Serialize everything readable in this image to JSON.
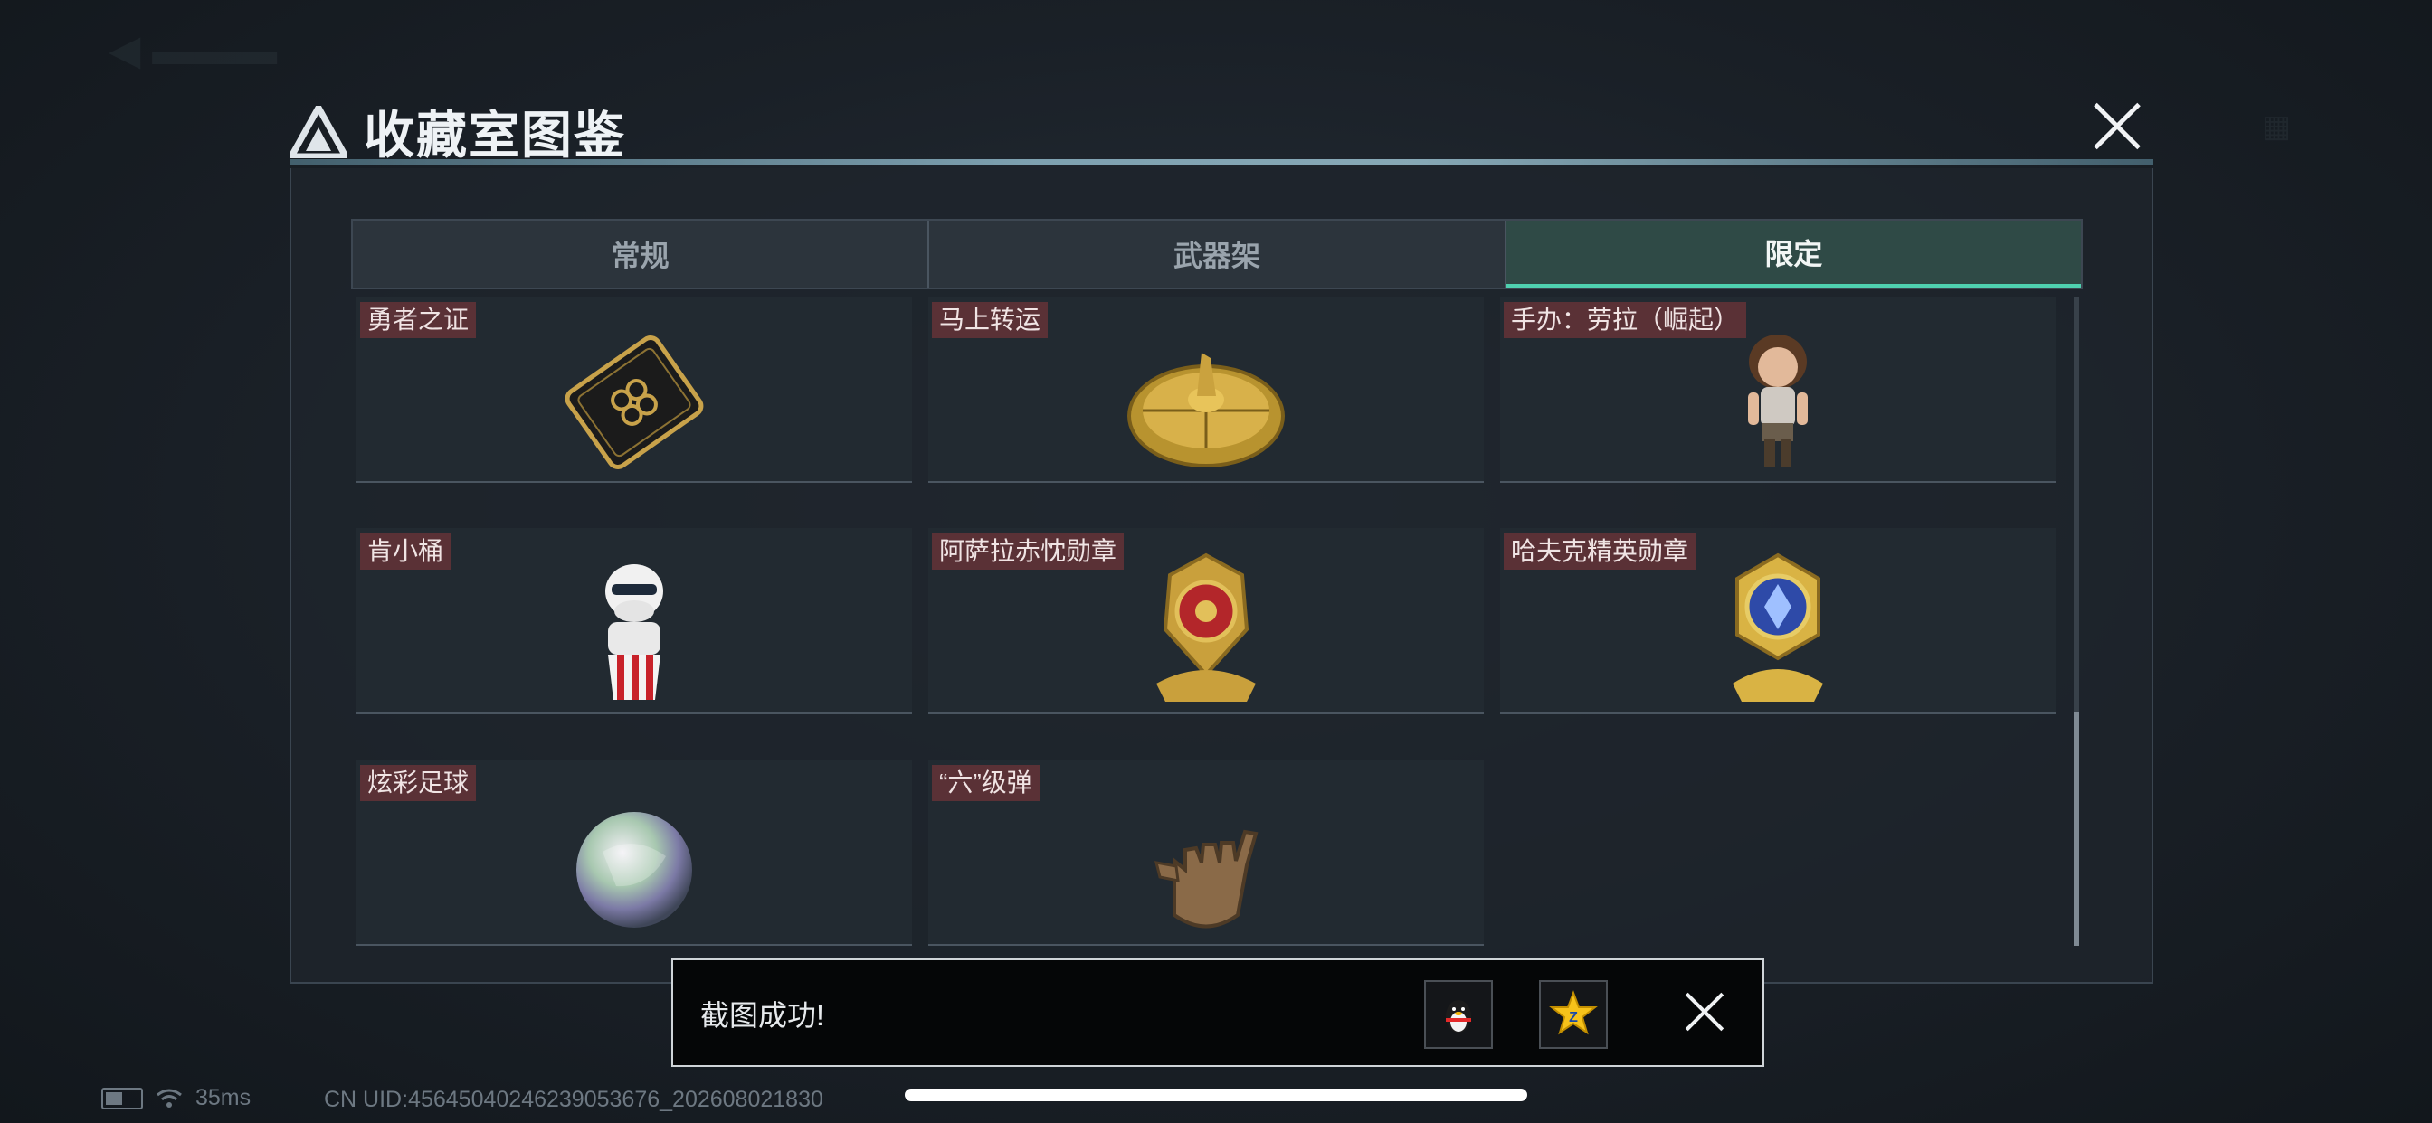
{
  "modal": {
    "title": "收藏室图鉴"
  },
  "tabs": [
    {
      "label": "常规",
      "active": false
    },
    {
      "label": "武器架",
      "active": false
    },
    {
      "label": "限定",
      "active": true
    }
  ],
  "items": [
    {
      "label": "勇者之证",
      "icon": "brave-card-icon"
    },
    {
      "label": "马上转运",
      "icon": "golden-wheel-icon"
    },
    {
      "label": "手办：劳拉（崛起）",
      "icon": "lara-figure-icon"
    },
    {
      "label": "肯小桶",
      "icon": "kfc-bucket-figure-icon"
    },
    {
      "label": "阿萨拉赤忱勋章",
      "icon": "red-medal-icon"
    },
    {
      "label": "哈夫克精英勋章",
      "icon": "blue-medal-icon"
    },
    {
      "label": "炫彩足球",
      "icon": "iridescent-ball-icon"
    },
    {
      "label": "“六”级弹",
      "icon": "bronze-hand-icon"
    }
  ],
  "toast": {
    "message": "截图成功!",
    "share_qq_icon": "qq-penguin-icon",
    "share_qzone_icon": "qzone-star-icon"
  },
  "status": {
    "ping": "35ms",
    "uid": "CN UID:45645040246239053676_202608021830"
  },
  "colors": {
    "active_tab_accent": "#4fd1b0",
    "label_bg": "#5a3136"
  }
}
